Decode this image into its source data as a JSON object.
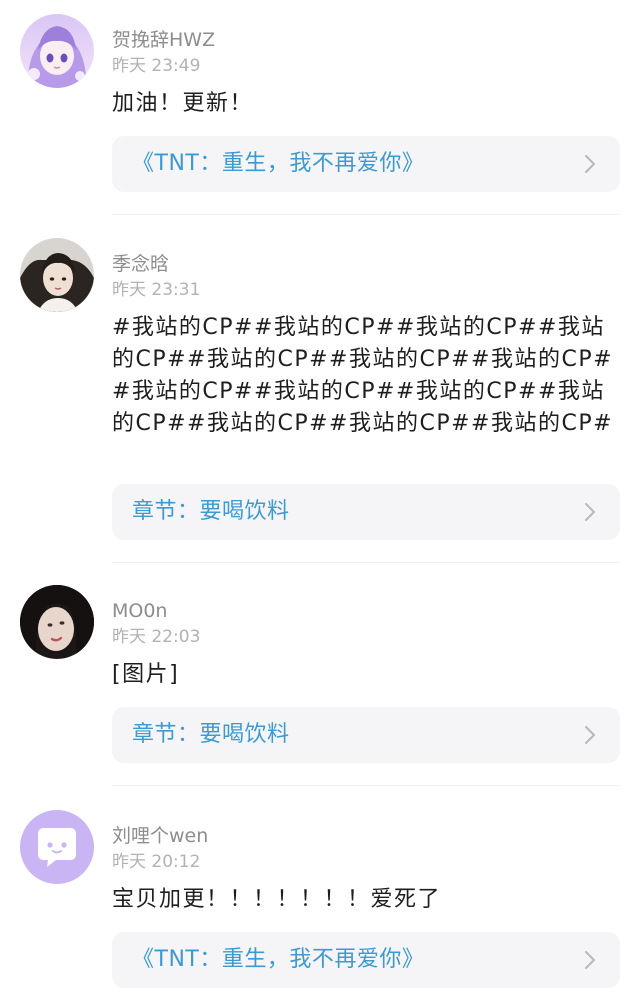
{
  "comments": [
    {
      "username": "贺挽辞HWZ",
      "timestamp": "昨天 23:49",
      "text": "加油！更新！",
      "link": {
        "label": "《TNT：重生，我不再爱你》",
        "icon": "chevron-right-icon"
      },
      "avatar": "anime-girl-avatar"
    },
    {
      "username": "季念晗",
      "timestamp": "昨天 23:31",
      "text": "#我站的CP##我站的CP##我站的CP##我站的CP##我站的CP##我站的CP##我站的CP##我站的CP##我站的CP##我站的CP##我站的CP##我站的CP##我站的CP##我站的CP#",
      "link": {
        "label": "章节：要喝饮料",
        "icon": "chevron-right-icon"
      },
      "avatar": "photo-avatar"
    },
    {
      "username": "MO0n",
      "timestamp": "昨天 22:03",
      "text": "[图片]",
      "link": {
        "label": "章节：要喝饮料",
        "icon": "chevron-right-icon"
      },
      "avatar": "photo-avatar"
    },
    {
      "username": "刘哩个wen",
      "timestamp": "昨天 20:12",
      "text": "宝贝加更！！！！！！！爱死了",
      "link": {
        "label": "《TNT：重生，我不再爱你》",
        "icon": "chevron-right-icon"
      },
      "avatar": "chat-bubble-avatar"
    }
  ],
  "colors": {
    "link": "#3d9ad1",
    "card_bg": "#f5f5f7",
    "username": "#8d8d8d",
    "timestamp": "#b2b2b2",
    "text": "#1e1e1e",
    "default_avatar": "#c9b5f3"
  }
}
